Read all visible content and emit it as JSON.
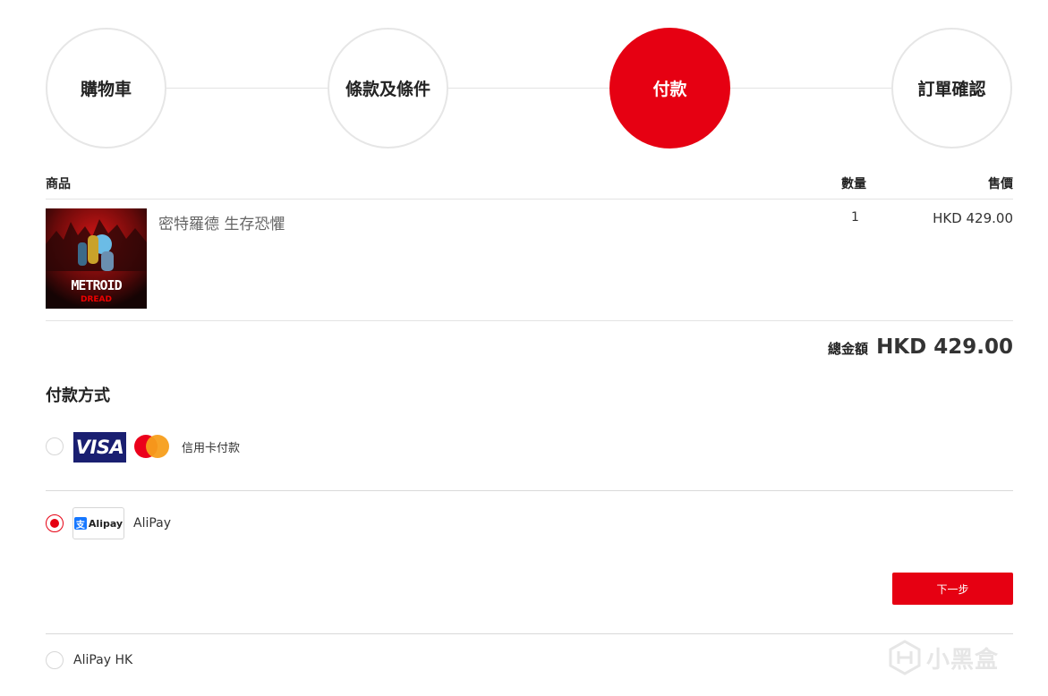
{
  "steps": [
    {
      "label": "購物車"
    },
    {
      "label": "條款及條件"
    },
    {
      "label": "付款",
      "active": true
    },
    {
      "label": "訂單確認"
    }
  ],
  "table": {
    "headers": {
      "product": "商品",
      "quantity": "數量",
      "price": "售價"
    },
    "items": [
      {
        "name": "密特羅德 生存恐懼",
        "quantity": "1",
        "price": "HKD 429.00",
        "thumbnail_title": "METROID",
        "thumbnail_subtitle": "DREAD"
      }
    ]
  },
  "total": {
    "label": "總金額",
    "amount": "HKD 429.00"
  },
  "payment": {
    "title": "付款方式",
    "methods": [
      {
        "id": "card",
        "label": "信用卡付款",
        "checked": false,
        "logos": [
          "VISA",
          "mastercard-icon"
        ]
      },
      {
        "id": "alipay",
        "label": "AliPay",
        "checked": true,
        "logo_text": "Alipay",
        "logo_mark": "支"
      },
      {
        "id": "alipayhk",
        "label": "AliPay HK",
        "checked": false
      }
    ],
    "next_button": "下一步"
  },
  "watermark": {
    "text": "小黑盒"
  },
  "colors": {
    "accent": "#e60012",
    "visa_blue": "#1a1f71",
    "mc_red": "#eb001b",
    "mc_orange": "#f79e1b",
    "alipay_blue": "#1677ff"
  }
}
